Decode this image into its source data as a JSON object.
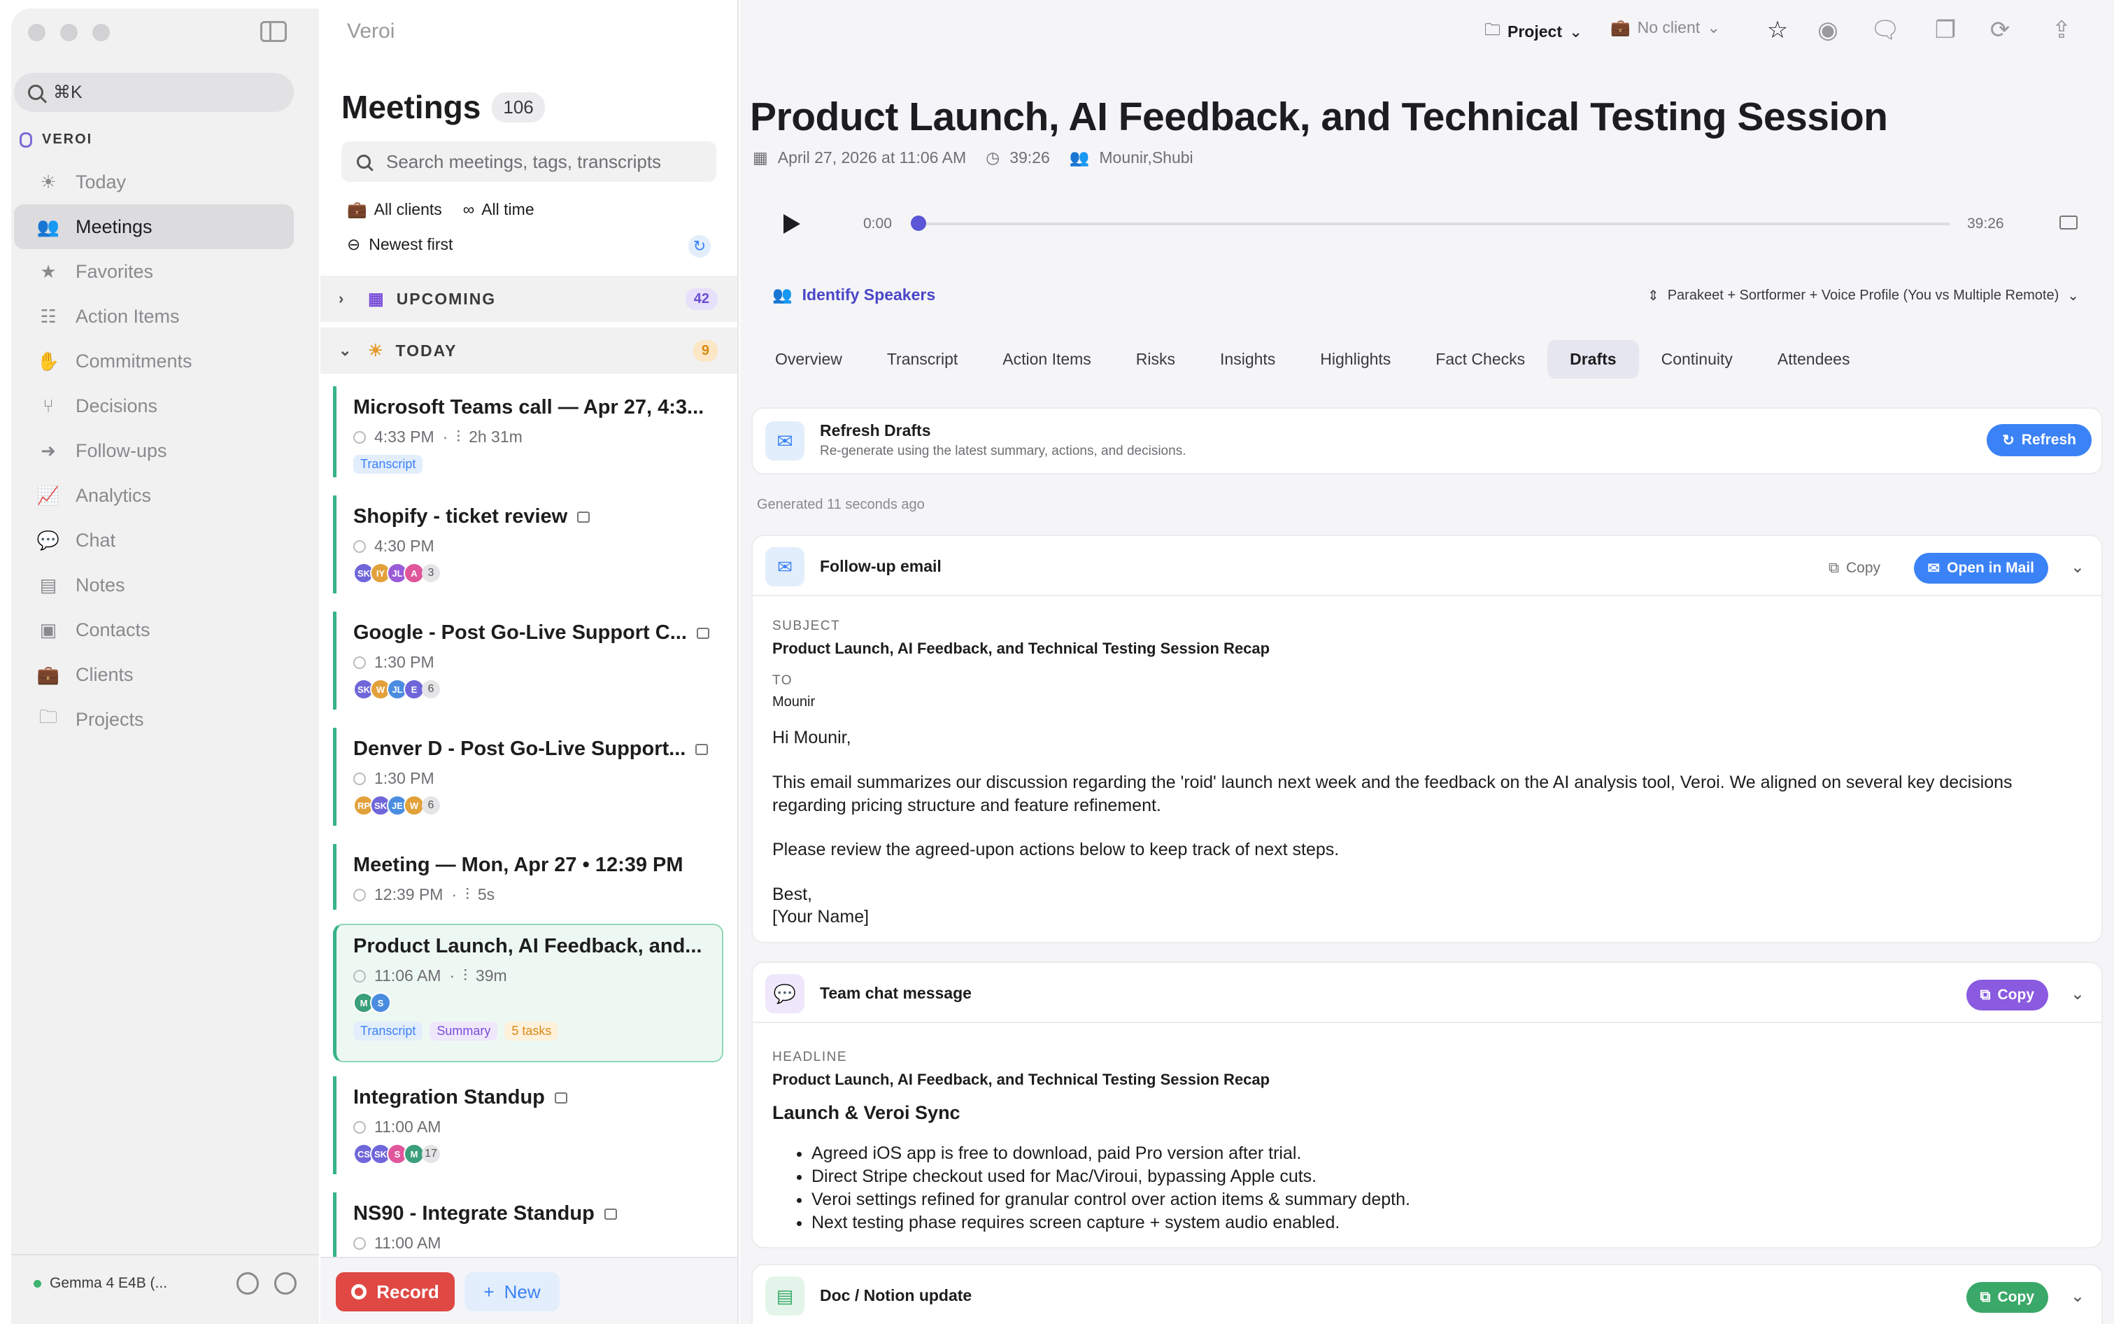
{
  "sidebar": {
    "search_label": "⌘K",
    "workspace": "VEROI",
    "items": [
      {
        "label": "Today",
        "icon": "sun-icon"
      },
      {
        "label": "Meetings",
        "icon": "people-icon",
        "active": true
      },
      {
        "label": "Favorites",
        "icon": "star-icon"
      },
      {
        "label": "Action Items",
        "icon": "checklist-icon"
      },
      {
        "label": "Commitments",
        "icon": "hand-icon"
      },
      {
        "label": "Decisions",
        "icon": "branch-icon"
      },
      {
        "label": "Follow-ups",
        "icon": "arrow-icon"
      },
      {
        "label": "Analytics",
        "icon": "chart-icon"
      },
      {
        "label": "Chat",
        "icon": "chat-icon"
      },
      {
        "label": "Notes",
        "icon": "note-icon"
      },
      {
        "label": "Contacts",
        "icon": "contact-icon"
      },
      {
        "label": "Clients",
        "icon": "briefcase-icon"
      },
      {
        "label": "Projects",
        "icon": "folder-icon"
      }
    ],
    "model": "Gemma 4 E4B (..."
  },
  "list": {
    "app_title": "Veroi",
    "title": "Meetings",
    "count": "106",
    "search_placeholder": "Search meetings, tags, transcripts",
    "filter_clients": "All clients",
    "filter_time": "All time",
    "sort": "Newest first",
    "upcoming": {
      "label": "UPCOMING",
      "count": "42"
    },
    "today": {
      "label": "TODAY",
      "count": "9"
    },
    "meetings": [
      {
        "title": "Microsoft Teams call — Apr 27, 4:3...",
        "time": "4:33 PM",
        "duration": "2h 31m",
        "tags": [
          "Transcript"
        ]
      },
      {
        "title": "Shopify - ticket review",
        "time": "4:30 PM",
        "avatars": [
          "SK",
          "IY",
          "JL",
          "A"
        ],
        "more": "3"
      },
      {
        "title": "Google - Post Go-Live Support C...",
        "time": "1:30 PM",
        "avatars": [
          "SK",
          "W",
          "JL",
          "E"
        ],
        "more": "6"
      },
      {
        "title": "Denver D - Post Go-Live Support...",
        "time": "1:30 PM",
        "avatars": [
          "RP",
          "SK",
          "JE",
          "W"
        ],
        "more": "6"
      },
      {
        "title": "Meeting — Mon, Apr 27 • 12:39 PM",
        "time": "12:39 PM",
        "duration": "5s"
      },
      {
        "title": "Product Launch, AI Feedback, and...",
        "time": "11:06 AM",
        "duration": "39m",
        "avatars": [
          "M",
          "S"
        ],
        "tags": [
          "Transcript",
          "Summary",
          "5 tasks"
        ]
      },
      {
        "title": "Integration Standup",
        "time": "11:00 AM",
        "avatars": [
          "CS",
          "SK",
          "S",
          "M"
        ],
        "more": "17"
      },
      {
        "title": "NS90 - Integrate Standup",
        "time": "11:00 AM"
      }
    ],
    "record": "Record",
    "new": "New"
  },
  "topbar": {
    "project": "Project",
    "client": "No client"
  },
  "meeting": {
    "title": "Product Launch, AI Feedback, and Technical Testing Session",
    "date": "April 27, 2026 at 11:06 AM",
    "duration": "39:26",
    "attendees": "Mounir,Shubi",
    "time_start": "0:00",
    "time_end": "39:26",
    "identify": "Identify Speakers",
    "model": "Parakeet + Sortformer + Voice Profile (You vs Multiple Remote)",
    "tabs": [
      "Overview",
      "Transcript",
      "Action Items",
      "Risks",
      "Insights",
      "Highlights",
      "Fact Checks",
      "Drafts",
      "Continuity",
      "Attendees"
    ],
    "active_tab": "Drafts"
  },
  "drafts": {
    "refresh_title": "Refresh Drafts",
    "refresh_sub": "Re-generate using the latest summary, actions, and decisions.",
    "refresh_btn": "Refresh",
    "generated": "Generated 11 seconds ago",
    "email": {
      "title": "Follow-up email",
      "copy": "Copy",
      "open": "Open in Mail",
      "subject_label": "SUBJECT",
      "subject": "Product Launch, AI Feedback, and Technical Testing Session Recap",
      "to_label": "TO",
      "to": "Mounir",
      "greeting": "Hi Mounir,",
      "p1": "This email summarizes our discussion regarding the 'roid' launch next week and the feedback on the AI analysis tool, Veroi. We aligned on several key decisions regarding pricing structure and feature refinement.",
      "p2": "Please review the agreed-upon actions below to keep track of next steps.",
      "sign1": "Best,",
      "sign2": "[Your Name]"
    },
    "chat": {
      "title": "Team chat message",
      "copy": "Copy",
      "headline_label": "HEADLINE",
      "headline": "Product Launch, AI Feedback, and Technical Testing Session Recap",
      "heading": "Launch & Veroi Sync",
      "bullets": [
        "Agreed iOS app is free to download, paid Pro version after trial.",
        "Direct Stripe checkout used for Mac/Viroui, bypassing Apple cuts.",
        "Veroi settings refined for granular control over action items & summary depth.",
        "Next testing phase requires screen capture + system audio enabled."
      ]
    },
    "doc": {
      "title": "Doc / Notion update",
      "copy": "Copy"
    }
  }
}
